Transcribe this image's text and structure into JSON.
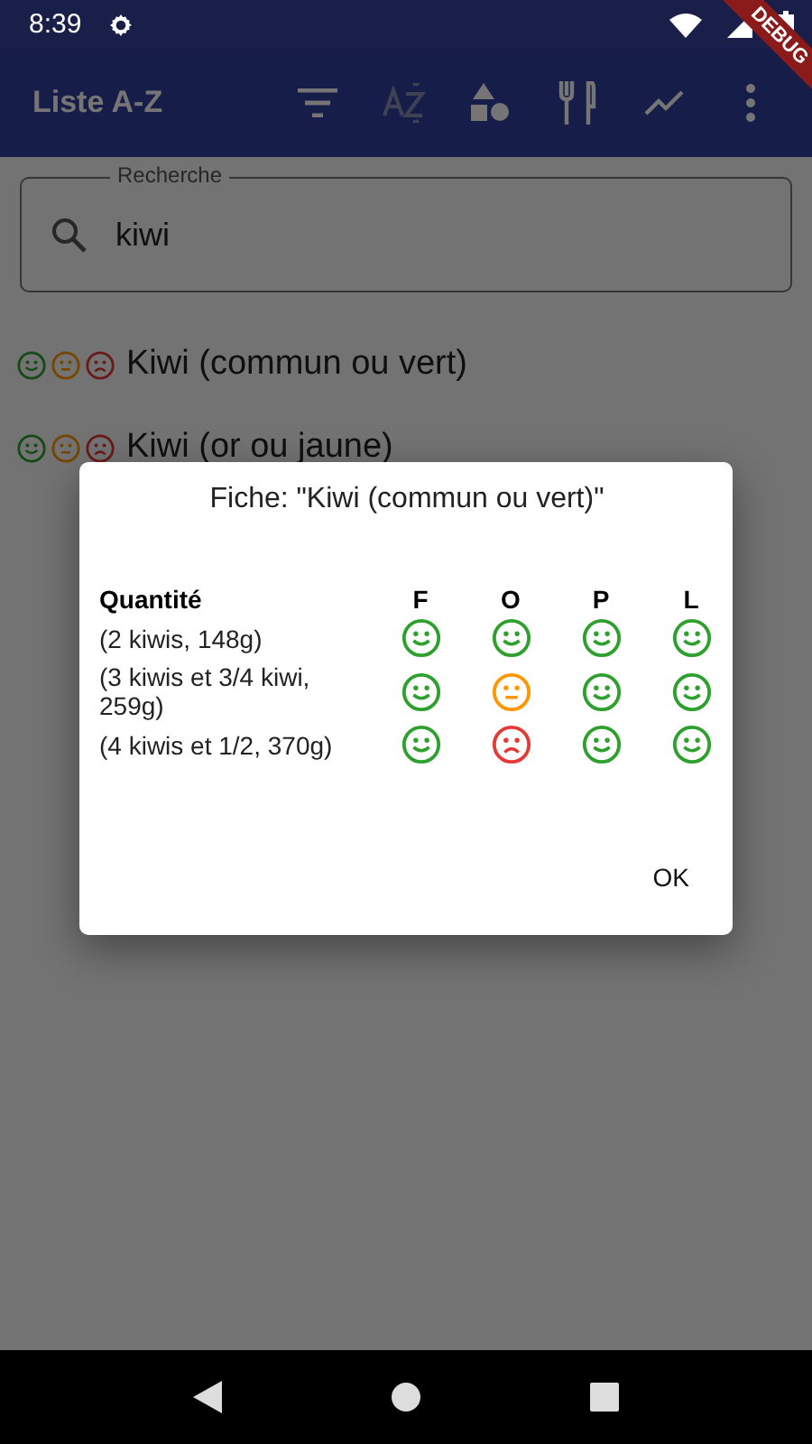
{
  "status_bar": {
    "time": "8:39"
  },
  "app_bar": {
    "title": "Liste A-Z"
  },
  "debug_banner": "DEBUG",
  "search": {
    "label": "Recherche",
    "value": "kiwi"
  },
  "items": [
    {
      "name": "Kiwi (commun ou vert)",
      "moods": [
        {
          "kind": "good"
        },
        {
          "kind": "neutral"
        },
        {
          "kind": "bad"
        }
      ]
    },
    {
      "name": "Kiwi (or ou jaune)",
      "moods": [
        {
          "kind": "good"
        },
        {
          "kind": "neutral"
        },
        {
          "kind": "bad"
        }
      ]
    }
  ],
  "dialog": {
    "title": "Fiche: \"Kiwi (commun ou vert)\"",
    "columns": [
      "Quantité",
      "F",
      "O",
      "P",
      "L"
    ],
    "rows": [
      {
        "quantity": "(2 kiwis, 148g)",
        "ratings": [
          {
            "kind": "good"
          },
          {
            "kind": "good"
          },
          {
            "kind": "good"
          },
          {
            "kind": "good"
          }
        ]
      },
      {
        "quantity": "(3 kiwis et 3/4 kiwi, 259g)",
        "ratings": [
          {
            "kind": "good"
          },
          {
            "kind": "neutral"
          },
          {
            "kind": "good"
          },
          {
            "kind": "good"
          }
        ]
      },
      {
        "quantity": "(4 kiwis et 1/2, 370g)",
        "ratings": [
          {
            "kind": "good"
          },
          {
            "kind": "bad"
          },
          {
            "kind": "good"
          },
          {
            "kind": "good"
          }
        ]
      }
    ],
    "button": "OK"
  }
}
